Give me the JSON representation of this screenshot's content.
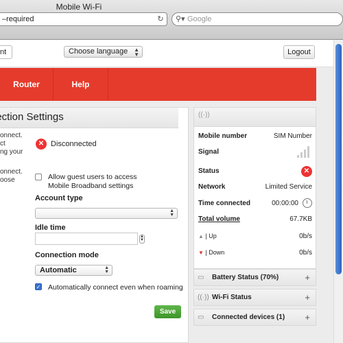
{
  "window": {
    "title": "Mobile Wi-Fi"
  },
  "browser": {
    "url_text": "–required",
    "search_placeholder": "Google"
  },
  "topbar": {
    "left_tab": "nt",
    "language_label": "Choose language",
    "logout_label": "Logout"
  },
  "nav": {
    "router": "Router",
    "help": "Help"
  },
  "left": {
    "header": "nection Settings",
    "cut_lines": [
      "onnect.",
      "ct",
      "ng your",
      "onnect.",
      "oose"
    ],
    "status": "Disconnected",
    "guest_label_1": "Allow guest users to access",
    "guest_label_2": "Mobile Broadband settings",
    "account_type_label": "Account type",
    "idle_time_label": "Idle time",
    "connection_mode_label": "Connection mode",
    "connection_mode_value": "Automatic",
    "roaming_label": "Automatically connect even when roaming",
    "save_label": "Save"
  },
  "right": {
    "mobile_number_label": "Mobile number",
    "mobile_number_value": "SIM Number",
    "signal_label": "Signal",
    "status_label": "Status",
    "network_label": "Network",
    "network_value": "Limited Service",
    "time_label": "Time connected",
    "time_value": "00:00:00",
    "total_label": "Total volume",
    "total_value": "67.7KB",
    "up_label": "Up",
    "up_value": "0b/s",
    "down_label": "Down",
    "down_value": "0b/s"
  },
  "accordions": {
    "battery": "Battery Status (70%)",
    "wifi": "Wi-Fi Status",
    "devices": "Connected devices (1)"
  },
  "icons": [
    "search-icon",
    "reload-icon",
    "antenna-icon",
    "battery-icon",
    "wifi-icon",
    "monitor-icon",
    "clock-icon",
    "error-icon"
  ]
}
